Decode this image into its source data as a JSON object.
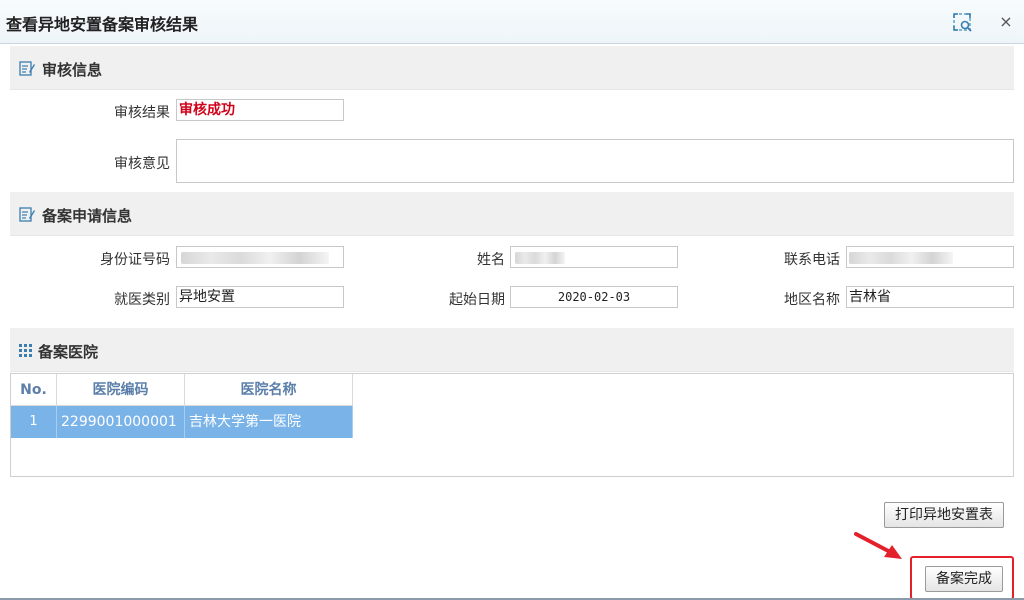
{
  "window": {
    "title": "查看异地安置备案审核结果",
    "maximize_icon": "maximize-icon",
    "close_label": "×"
  },
  "audit_section": {
    "title": "审核信息",
    "result_label": "审核结果",
    "result_value": "审核成功",
    "opinion_label": "审核意见",
    "opinion_value": ""
  },
  "application_section": {
    "title": "备案申请信息",
    "id_label": "身份证号码",
    "name_label": "姓名",
    "phone_label": "联系电话",
    "category_label": "就医类别",
    "category_value": "异地安置",
    "start_date_label": "起始日期",
    "start_date_value": "2020-02-03",
    "region_label": "地区名称",
    "region_value": "吉林省"
  },
  "hospital_section": {
    "title": "备案医院",
    "columns": [
      "No.",
      "医院编码",
      "医院名称"
    ],
    "rows": [
      {
        "no": "1",
        "code": "2299001000001",
        "name": "吉林大学第一医院"
      }
    ]
  },
  "actions": {
    "print_label": "打印异地安置表",
    "complete_label": "备案完成"
  },
  "colors": {
    "accent": "#e3212a",
    "selected_row": "#7ab3e8",
    "header_text": "#5b7faa",
    "success_text": "#d0021b"
  }
}
